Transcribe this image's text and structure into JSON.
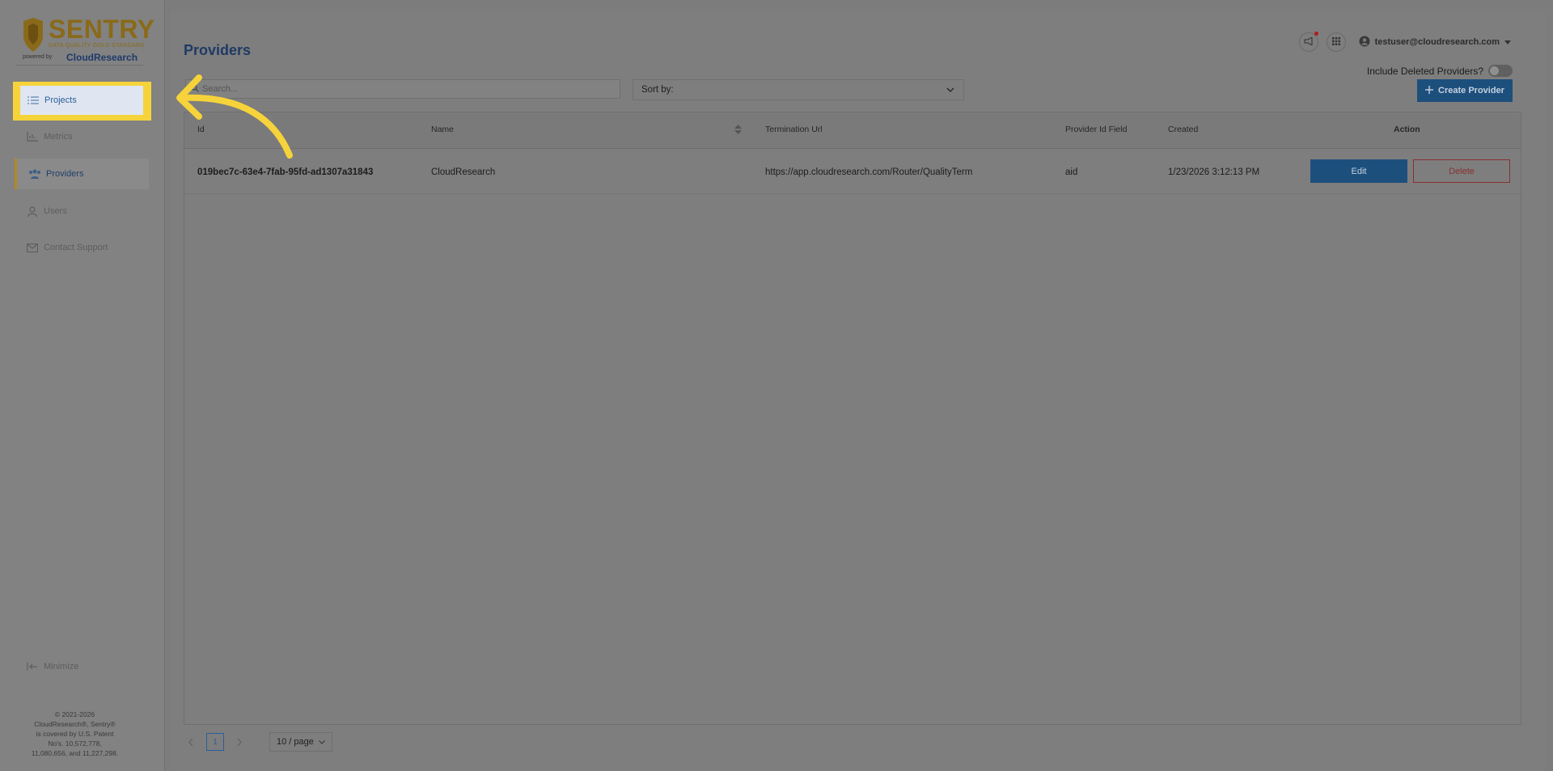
{
  "logo": {
    "brand": "SENTRY",
    "tagline": "DATA QUALITY GOLD STANDARD",
    "powered_by": "powered by",
    "company": "CloudResearch"
  },
  "sidebar": {
    "items": [
      {
        "label": "Projects",
        "icon": "list-icon"
      },
      {
        "label": "Metrics",
        "icon": "bar-chart-icon"
      },
      {
        "label": "Providers",
        "icon": "users-group-icon"
      },
      {
        "label": "Users",
        "icon": "user-icon"
      },
      {
        "label": "Contact Support",
        "icon": "mail-icon"
      }
    ],
    "minimize_label": "Minimize",
    "copyright": {
      "line1": "© 2021-2026",
      "line2": "CloudResearch®, Sentry®",
      "line3": "is covered by U.S. Patent",
      "line4": "No's. 10,572,778,",
      "line5": "11,080,656, and 11,227,298."
    }
  },
  "header": {
    "title": "Providers",
    "user_email": "testuser@cloudresearch.com"
  },
  "toolbar": {
    "search_placeholder": "Search...",
    "sort_label": "Sort by:",
    "include_deleted_label": "Include Deleted Providers?",
    "include_deleted_on": false,
    "create_label": "Create Provider"
  },
  "table": {
    "columns": [
      "Id",
      "Name",
      "Termination Url",
      "Provider Id Field",
      "Created",
      "Action"
    ],
    "rows": [
      {
        "id": "019bec7c-63e4-7fab-95fd-ad1307a31843",
        "name": "CloudResearch",
        "termination_url": "https://app.cloudresearch.com/Router/QualityTerm",
        "provider_id_field": "aid",
        "created": "1/23/2026 3:12:13 PM",
        "edit_label": "Edit",
        "delete_label": "Delete"
      }
    ]
  },
  "pagination": {
    "current_page": "1",
    "page_size": "10 / page"
  },
  "colors": {
    "highlight": "#f6d33a",
    "primary": "#1d4f7c",
    "danger": "#8a3030",
    "brand_gold": "#8a6a19"
  }
}
